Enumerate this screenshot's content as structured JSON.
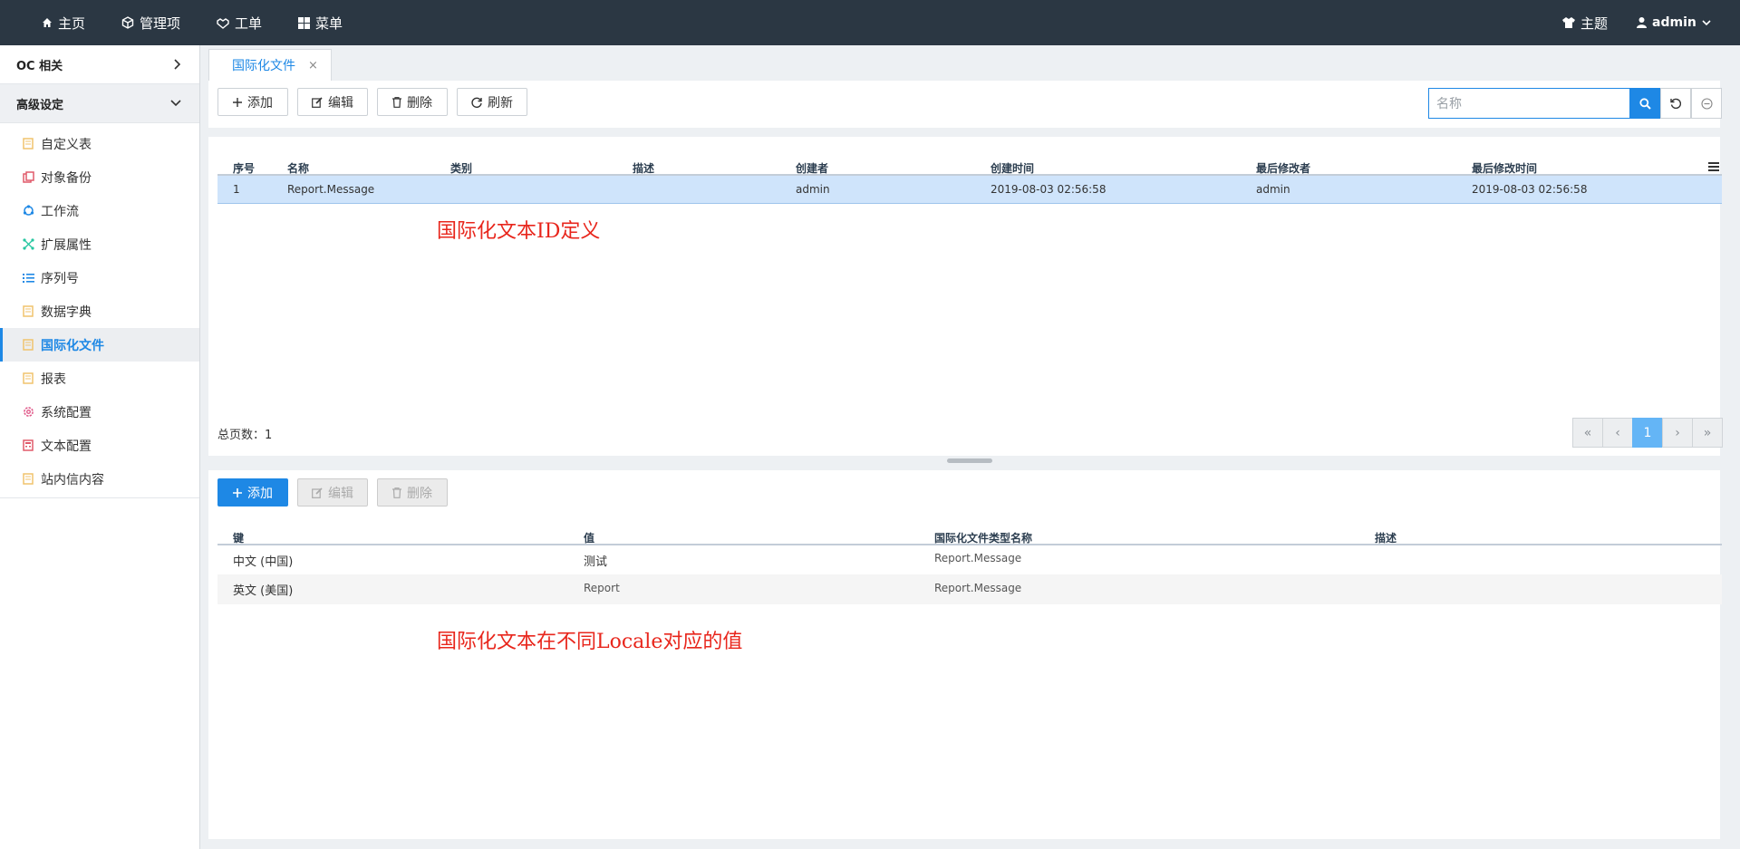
{
  "topnav": {
    "home": "主页",
    "manage": "管理项",
    "workorder": "工单",
    "menu": "菜单",
    "theme": "主题",
    "user": "admin"
  },
  "sidebar": {
    "group_oc": "OC 相关",
    "group_advanced": "高级设定",
    "items": [
      {
        "label": "自定义表",
        "icon": "folder-icon",
        "color": "#f0c36d"
      },
      {
        "label": "对象备份",
        "icon": "copy-icon",
        "color": "#e05a6a"
      },
      {
        "label": "工作流",
        "icon": "workflow-icon",
        "color": "#1e88e5"
      },
      {
        "label": "扩展属性",
        "icon": "network-icon",
        "color": "#26c6a0"
      },
      {
        "label": "序列号",
        "icon": "list-icon",
        "color": "#1e88e5"
      },
      {
        "label": "数据字典",
        "icon": "folder-icon",
        "color": "#f0c36d"
      },
      {
        "label": "国际化文件",
        "icon": "folder-icon",
        "color": "#f0c36d"
      },
      {
        "label": "报表",
        "icon": "folder-icon",
        "color": "#f0c36d"
      },
      {
        "label": "系统配置",
        "icon": "gear-icon",
        "color": "#e05a8a"
      },
      {
        "label": "文本配置",
        "icon": "calculator-icon",
        "color": "#e05a6a"
      },
      {
        "label": "站内信内容",
        "icon": "folder-icon",
        "color": "#f0c36d"
      }
    ]
  },
  "tab": {
    "label": "国际化文件",
    "close": "×"
  },
  "toolbar": {
    "add": "添加",
    "edit": "编辑",
    "delete": "删除",
    "refresh": "刷新",
    "search_placeholder": "名称"
  },
  "grid": {
    "columns": [
      "序号",
      "名称",
      "类别",
      "描述",
      "创建者",
      "创建时间",
      "最后修改者",
      "最后修改时间"
    ],
    "rows": [
      [
        "1",
        "Report.Message",
        "",
        "",
        "admin",
        "2019-08-03 02:56:58",
        "admin",
        "2019-08-03 02:56:58"
      ]
    ],
    "annotation": "国际化文本ID定义",
    "total_pages": "总页数：1",
    "pager": [
      "«",
      "‹",
      "1",
      "›",
      "»"
    ]
  },
  "detail": {
    "add": "添加",
    "edit": "编辑",
    "delete": "删除",
    "columns": [
      "键",
      "值",
      "国际化文件类型名称",
      "描述"
    ],
    "rows": [
      [
        "中文 (中国)",
        "测试",
        "Report.Message",
        ""
      ],
      [
        "英文 (美国)",
        "Report",
        "Report.Message",
        ""
      ]
    ],
    "annotation": "国际化文本在不同Locale对应的值"
  },
  "colors": {
    "topbar": "#2b3743",
    "accent": "#1e88e5",
    "selected_row": "#cfe4fb",
    "annotation": "#e8261c"
  }
}
